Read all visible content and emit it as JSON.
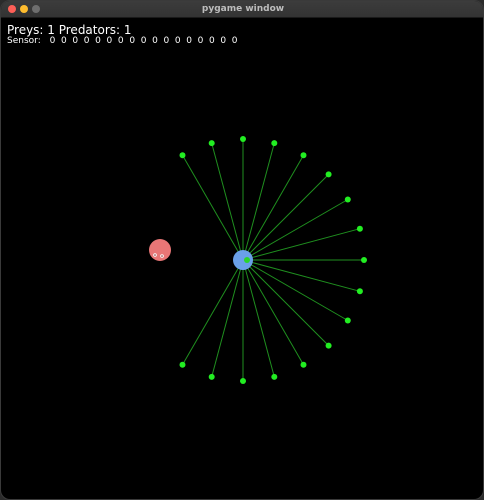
{
  "window": {
    "title": "pygame window"
  },
  "hud": {
    "counts_text": "Preys: 1 Predators: 1",
    "sensor_label": "Sensor:",
    "sensor_values": [
      "0",
      "0",
      "0",
      "0",
      "0",
      "0",
      "0",
      "0",
      "0",
      "0",
      "0",
      "0",
      "0",
      "0",
      "0",
      "0",
      "0"
    ]
  },
  "colors": {
    "background": "#000000",
    "ray": "#1f8f1f",
    "ray_tip": "#22ee22",
    "predator_body": "#e87676",
    "prey_body": "#6aa0e8",
    "prey_eye": "#2bd42b"
  },
  "entities": {
    "predator_name": "predator",
    "prey_name": "prey",
    "sensor_ray_count": 17
  }
}
